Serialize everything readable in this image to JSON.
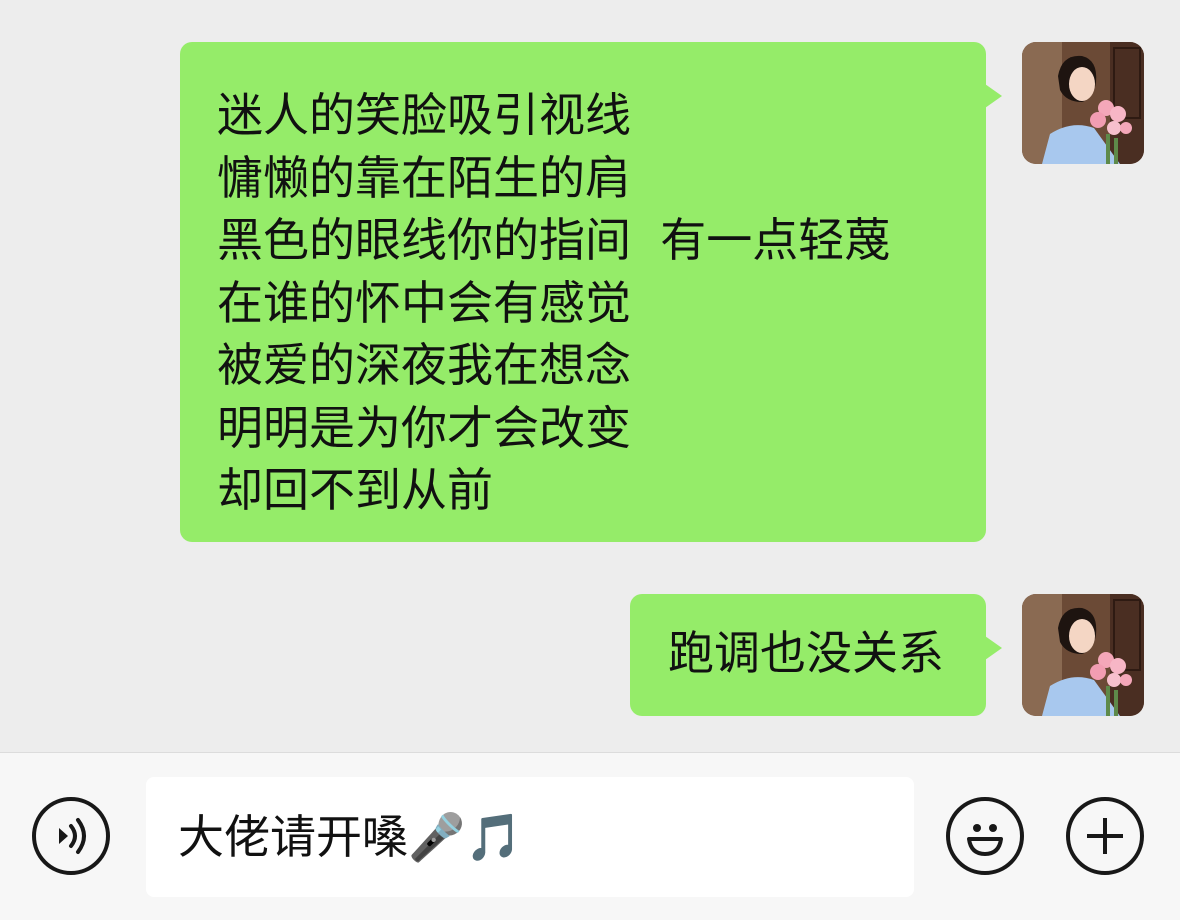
{
  "messages": [
    {
      "sender": "me",
      "lines": [
        "迷人的笑脸吸引视线",
        "慵懒的靠在陌生的肩",
        "黑色的眼线你的指间  有一点轻蔑",
        "在谁的怀中会有感觉",
        "被爱的深夜我在想念",
        "明明是为你才会改变",
        "却回不到从前"
      ]
    },
    {
      "sender": "me",
      "text": "跑调也没关系"
    }
  ],
  "input": {
    "value": "大佬请开嗓🎤🎵"
  },
  "icons": {
    "voice": "voice-icon",
    "emoji": "smiley-face-icon",
    "more": "plus-icon"
  },
  "colors": {
    "bubble": "#95ec69",
    "background": "#ededed",
    "input_bar": "#f7f7f7"
  }
}
